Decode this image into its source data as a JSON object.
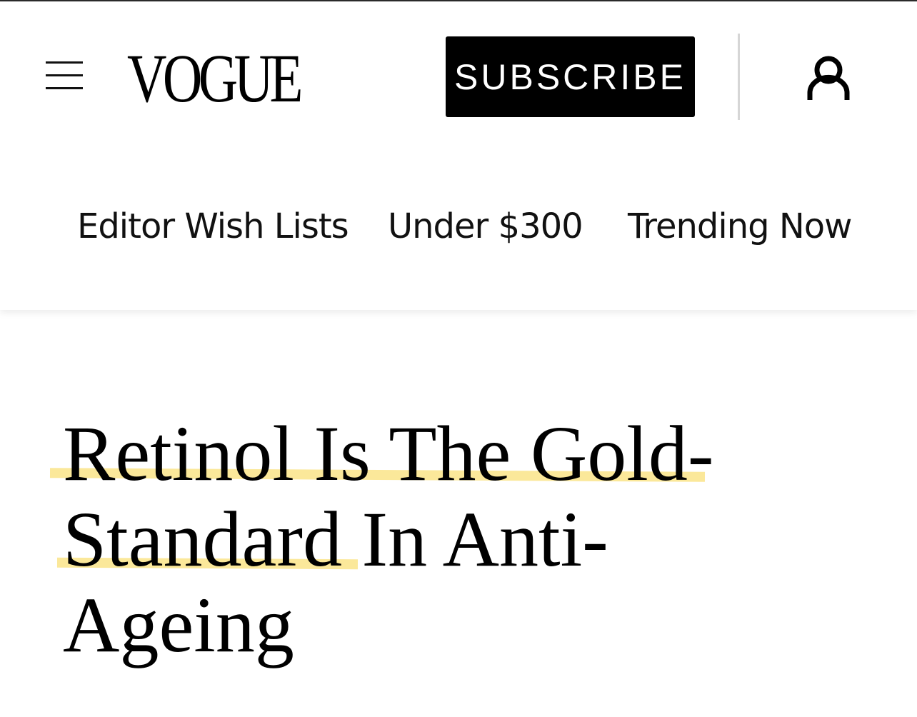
{
  "header": {
    "logo": "VOGUE",
    "subscribe_label": "SUBSCRIBE",
    "menu_icon": "hamburger-menu-icon",
    "account_icon": "user-account-icon"
  },
  "nav": {
    "items": [
      {
        "label": "Editor Wish Lists"
      },
      {
        "label": "Under $300"
      },
      {
        "label": "Trending Now"
      }
    ]
  },
  "article": {
    "headline_lines": [
      "Retinol Is The Gold-",
      "Standard In Anti-",
      "Ageing"
    ],
    "highlight_color": "#fbe89a"
  }
}
